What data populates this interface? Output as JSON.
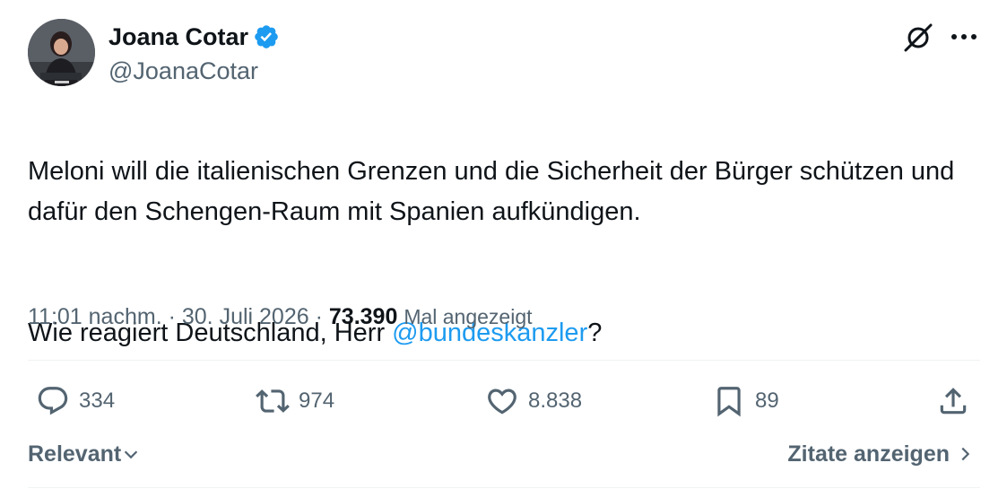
{
  "author": {
    "name": "Joana Cotar",
    "handle": "@JoanaCotar",
    "verified": true
  },
  "tweet": {
    "line1": "Meloni will die italienischen Grenzen und die Sicherheit der Bürger schützen und dafür den Schengen-Raum mit Spanien aufkündigen.",
    "line2_prefix": "Wie reagiert Deutschland, Herr ",
    "mention": "@bundeskanzler",
    "line2_suffix": "?"
  },
  "meta": {
    "time": "11:01 nachm.",
    "separator": "·",
    "date": "30. Juli 2026",
    "views": "73.390",
    "views_label": "Mal angezeigt"
  },
  "actions": {
    "replies": "334",
    "reposts": "974",
    "likes": "8.838",
    "bookmarks": "89"
  },
  "footer": {
    "sort_label": "Relevant",
    "quotes_label": "Zitate anzeigen"
  },
  "colors": {
    "accent": "#1d9bf0",
    "text": "#0f1419",
    "muted": "#536471",
    "divider": "#eff3f4"
  },
  "icons": [
    "grok-icon",
    "more-icon",
    "reply-icon",
    "repost-icon",
    "like-icon",
    "bookmark-icon",
    "share-icon",
    "chevron-down-icon",
    "chevron-right-icon",
    "verified-badge-icon"
  ]
}
